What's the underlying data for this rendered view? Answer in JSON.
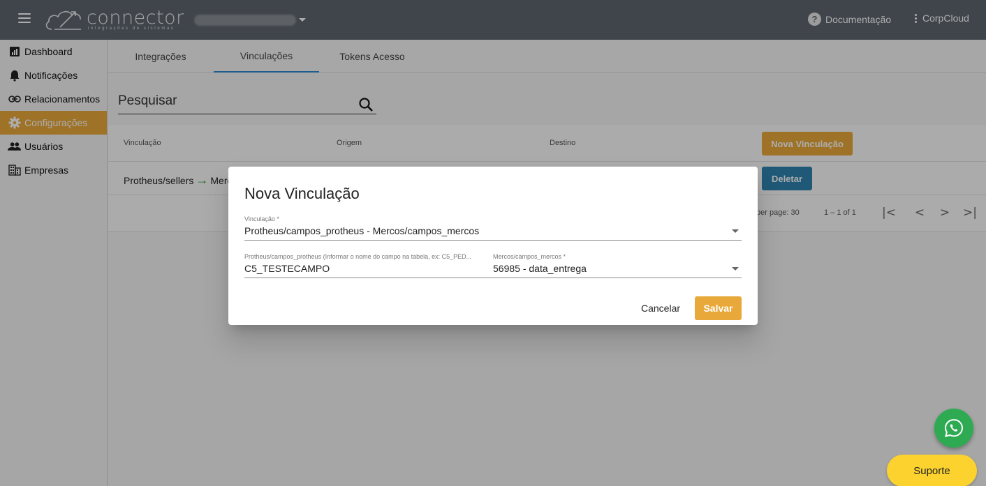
{
  "topbar": {
    "logo_text": "connector",
    "logo_subtitle": "integrações de sistemas",
    "docs_label": "Documentação",
    "org_label": "CorpCloud"
  },
  "sidebar": {
    "items": [
      {
        "label": "Dashboard",
        "icon": "chart-icon"
      },
      {
        "label": "Notificações",
        "icon": "bell-icon"
      },
      {
        "label": "Relacionamentos",
        "icon": "link-icon"
      },
      {
        "label": "Configurações",
        "icon": "gear-icon",
        "active": true
      },
      {
        "label": "Usuários",
        "icon": "users-icon"
      },
      {
        "label": "Empresas",
        "icon": "building-icon"
      }
    ]
  },
  "tabs": [
    "Integrações",
    "Vinculações",
    "Tokens Acesso"
  ],
  "active_tab": "Vinculações",
  "search": {
    "placeholder": "Pesquisar"
  },
  "table": {
    "headers": [
      "Vinculação",
      "Origem",
      "Destino"
    ],
    "new_button": "Nova Vinculação",
    "rows": [
      {
        "origin": "Protheus/sellers",
        "dest_partial": "Merc",
        "delete_label": "Deletar"
      }
    ]
  },
  "paginator": {
    "per_page_label": "per page: 30",
    "range_label": "1 – 1 of 1"
  },
  "dialog": {
    "title": "Nova Vinculação",
    "vinculacao_label": "Vinculação *",
    "vinculacao_value": "Protheus/campos_protheus - Mercos/campos_mercos",
    "origin_label": "Protheus/campos_protheus (Informar o nome do campo na tabela, ex: C5_PED...",
    "origin_value": "C5_TESTECAMPO",
    "dest_label": "Mercos/campos_mercos *",
    "dest_value": "56985 - data_entrega",
    "cancel_label": "Cancelar",
    "save_label": "Salvar"
  },
  "support_label": "Suporte",
  "colors": {
    "accent": "#e9a93a",
    "topbar": "#5f6670",
    "delete": "#2f83b0",
    "whatsapp": "#2eaa52",
    "support": "#fbd22e"
  }
}
